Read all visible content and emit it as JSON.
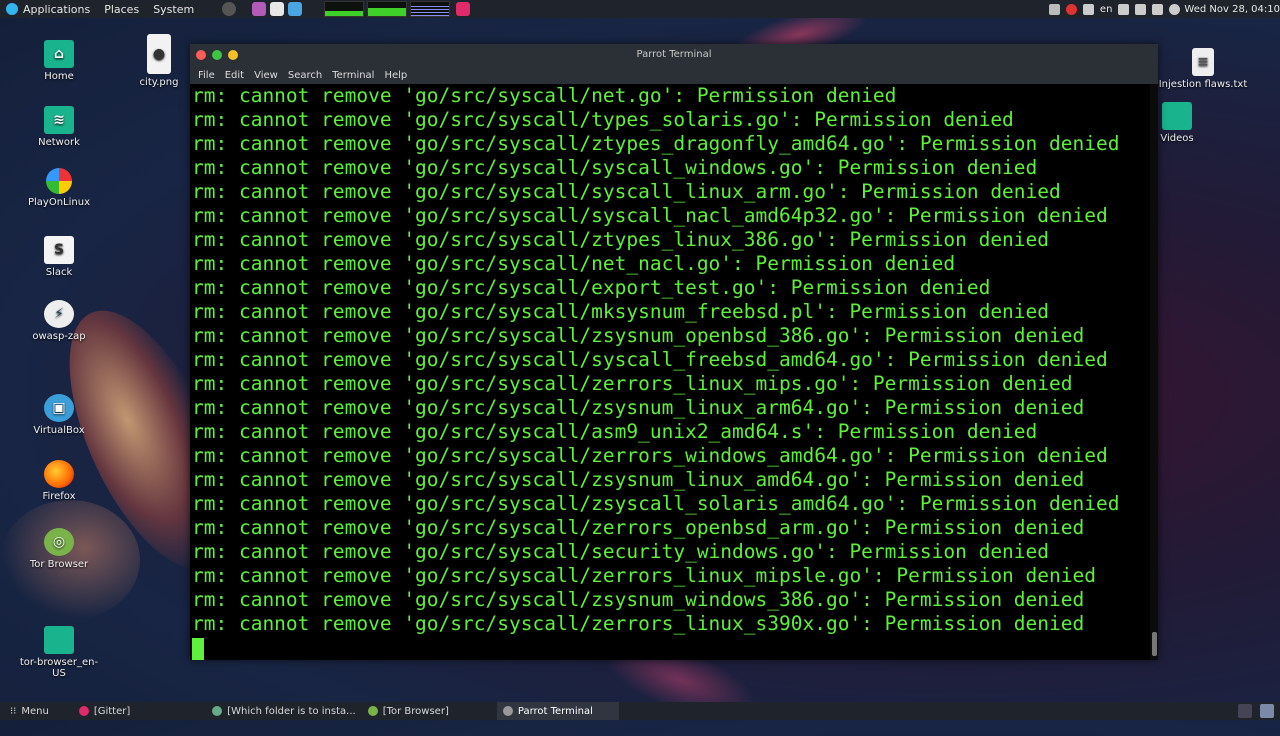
{
  "top_panel": {
    "menus": [
      "Applications",
      "Places",
      "System"
    ],
    "keyboard_layout": "en",
    "clock": "Wed Nov 28, 04:10"
  },
  "desktop": {
    "icons": [
      {
        "label": "Home"
      },
      {
        "label": "city.png"
      },
      {
        "label": "Network"
      },
      {
        "label": "PlayOnLinux"
      },
      {
        "label": "Slack"
      },
      {
        "label": "owasp-zap"
      },
      {
        "label": "VirtualBox"
      },
      {
        "label": "Firefox"
      },
      {
        "label": "Tor Browser"
      },
      {
        "label": "tor-browser_en-US"
      },
      {
        "label": "Injestion flaws.txt"
      },
      {
        "label": "Videos"
      }
    ]
  },
  "terminal": {
    "title": "Parrot Terminal",
    "menu": [
      "File",
      "Edit",
      "View",
      "Search",
      "Terminal",
      "Help"
    ],
    "lines": [
      "rm: cannot remove 'go/src/syscall/net.go': Permission denied",
      "rm: cannot remove 'go/src/syscall/types_solaris.go': Permission denied",
      "rm: cannot remove 'go/src/syscall/ztypes_dragonfly_amd64.go': Permission denied",
      "rm: cannot remove 'go/src/syscall/syscall_windows.go': Permission denied",
      "rm: cannot remove 'go/src/syscall/syscall_linux_arm.go': Permission denied",
      "rm: cannot remove 'go/src/syscall/syscall_nacl_amd64p32.go': Permission denied",
      "rm: cannot remove 'go/src/syscall/ztypes_linux_386.go': Permission denied",
      "rm: cannot remove 'go/src/syscall/net_nacl.go': Permission denied",
      "rm: cannot remove 'go/src/syscall/export_test.go': Permission denied",
      "rm: cannot remove 'go/src/syscall/mksysnum_freebsd.pl': Permission denied",
      "rm: cannot remove 'go/src/syscall/zsysnum_openbsd_386.go': Permission denied",
      "rm: cannot remove 'go/src/syscall/syscall_freebsd_amd64.go': Permission denied",
      "rm: cannot remove 'go/src/syscall/zerrors_linux_mips.go': Permission denied",
      "rm: cannot remove 'go/src/syscall/zsysnum_linux_arm64.go': Permission denied",
      "rm: cannot remove 'go/src/syscall/asm9_unix2_amd64.s': Permission denied",
      "rm: cannot remove 'go/src/syscall/zerrors_windows_amd64.go': Permission denied",
      "rm: cannot remove 'go/src/syscall/zsysnum_linux_amd64.go': Permission denied",
      "rm: cannot remove 'go/src/syscall/zsyscall_solaris_amd64.go': Permission denied",
      "rm: cannot remove 'go/src/syscall/zerrors_openbsd_arm.go': Permission denied",
      "rm: cannot remove 'go/src/syscall/security_windows.go': Permission denied",
      "rm: cannot remove 'go/src/syscall/zerrors_linux_mipsle.go': Permission denied",
      "rm: cannot remove 'go/src/syscall/zsysnum_windows_386.go': Permission denied",
      "rm: cannot remove 'go/src/syscall/zerrors_linux_s390x.go': Permission denied"
    ]
  },
  "taskbar": {
    "menu_label": "Menu",
    "tasks": [
      {
        "label": "[Gitter]"
      },
      {
        "label": "[Which folder is to insta..."
      },
      {
        "label": "[Tor Browser]"
      },
      {
        "label": "Parrot Terminal"
      }
    ]
  },
  "colors": {
    "terminal_text": "#5ef03a",
    "panel_bg": "#1f232b",
    "folder": "#19b38d"
  }
}
